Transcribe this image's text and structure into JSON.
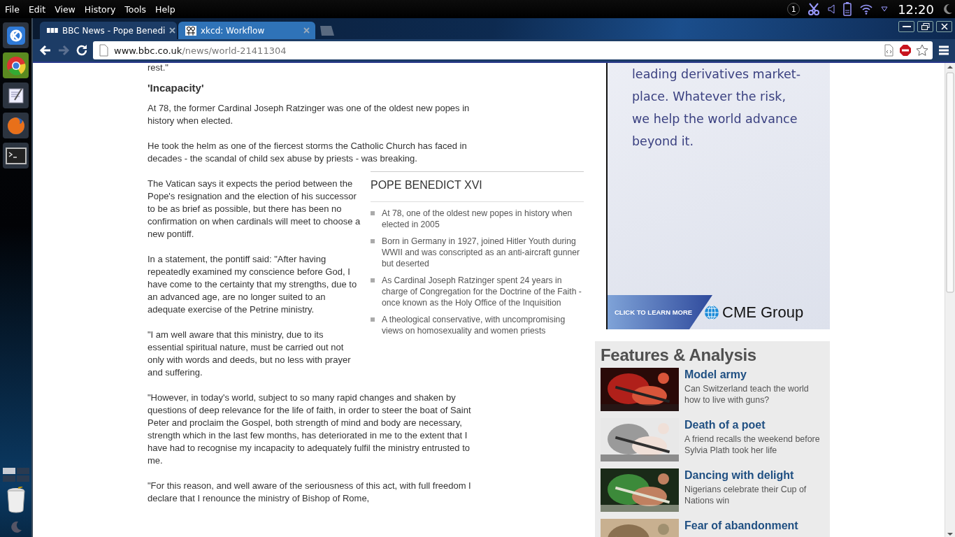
{
  "desktop_menu": [
    "File",
    "Edit",
    "View",
    "History",
    "Tools",
    "Help"
  ],
  "tray": {
    "workspace": "1",
    "clock": "12:20"
  },
  "dock": [
    {
      "kind": "kde",
      "selected": false
    },
    {
      "kind": "chrome",
      "selected": true
    },
    {
      "kind": "editor",
      "selected": false
    },
    {
      "kind": "firefox",
      "selected": false
    },
    {
      "kind": "terminal",
      "selected": false
    }
  ],
  "tabs": [
    {
      "title": "BBC News - Pope Benedi",
      "kind": "bbc",
      "selected": true
    },
    {
      "title": "xkcd: Workflow",
      "kind": "xkcd",
      "selected": false
    }
  ],
  "address": {
    "host": "www.bbc.co.uk",
    "path": "/news/world-21411304"
  },
  "article": {
    "lead_fragment": "rest.\"",
    "heading": "'Incapacity'",
    "body": [
      {
        "kind": "paragraph",
        "text": "At 78, the former Cardinal Joseph Ratzinger was one of the oldest new popes in history when elected."
      },
      {
        "kind": "paragraph",
        "text": "He took the helm as one of the fiercest storms the Catholic Church has faced in decades - the scandal of child sex abuse by priests - was breaking."
      },
      {
        "kind": "split",
        "paragraphs": [
          "The Vatican says it expects the period between the Pope's resignation and the election of his successor to be as brief as possible, but there has been no confirmation on when cardinals will meet to choose a new pontiff.",
          "In a statement, the pontiff said: \"After having repeatedly examined my conscience before God, I have come to the certainty that my strengths, due to an advanced age, are no longer suited to an adequate exercise of the Petrine ministry.",
          "\"I am well aware that this ministry, due to its essential spiritual nature, must be carried out not only with words and deeds, but no less with prayer and suffering."
        ],
        "factbox": {
          "title": "POPE BENEDICT XVI",
          "items": [
            "At 78, one of the oldest new popes in history when elected in 2005",
            "Born in Germany in 1927, joined Hitler Youth during WWII and was conscripted as an anti-aircraft gunner but deserted",
            "As Cardinal Joseph Ratzinger spent 24 years in charge of Congregation for the Doctrine of the Faith - once known as the Holy Office of the Inquisition",
            "A theological conservative, with uncompromising views on homosexuality and women priests"
          ]
        }
      },
      {
        "kind": "paragraph",
        "text": "\"However, in today's world, subject to so many rapid changes and shaken by questions of deep relevance for the life of faith, in order to steer the boat of Saint Peter and proclaim the Gospel, both strength of mind and body are necessary, strength which in the last few months, has deteriorated in me to the extent that I have had to recognise my incapacity to adequately fulfil the ministry entrusted to me."
      },
      {
        "kind": "paragraph",
        "text": "\"For this reason, and well aware of the seriousness of this act, with full freedom I declare that I renounce the ministry of Bishop of Rome,"
      }
    ]
  },
  "ad": {
    "lines": [
      "leading derivatives market-",
      "place. Whatever the risk,",
      "we help the world advance",
      "beyond it."
    ],
    "cta": "CLICK TO LEARN MORE",
    "brand": "CME Group"
  },
  "features": {
    "title": "Features & Analysis",
    "items": [
      {
        "headline": "Model army",
        "summary": "Can Switzerland teach the world how to live with guns?"
      },
      {
        "headline": "Death of a poet",
        "summary": "A friend recalls the weekend before Sylvia Plath took her life"
      },
      {
        "headline": "Dancing with delight",
        "summary": "Nigerians celebrate their Cup of Nations win"
      },
      {
        "headline": "Fear of abandonment"
      }
    ]
  }
}
